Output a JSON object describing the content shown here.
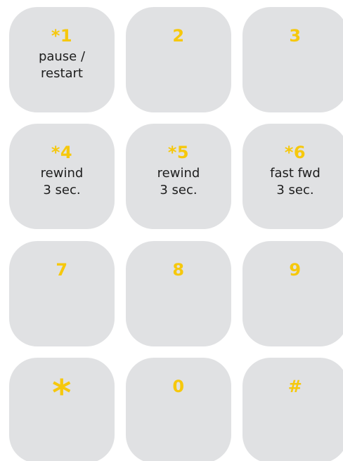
{
  "keypad": {
    "keys": [
      {
        "label": "*1",
        "desc": "pause /\nrestart"
      },
      {
        "label": "2",
        "desc": ""
      },
      {
        "label": "3",
        "desc": ""
      },
      {
        "label": "*4",
        "desc": "rewind\n3 sec."
      },
      {
        "label": "*5",
        "desc": "rewind\n3 sec."
      },
      {
        "label": "*6",
        "desc": "fast fwd\n3 sec."
      },
      {
        "label": "7",
        "desc": ""
      },
      {
        "label": "8",
        "desc": ""
      },
      {
        "label": "9",
        "desc": ""
      },
      {
        "label": "*",
        "desc": ""
      },
      {
        "label": "0",
        "desc": ""
      },
      {
        "label": "#",
        "desc": ""
      }
    ],
    "colors": {
      "key_background": "#e0e1e3",
      "label_accent": "#f6c80c",
      "desc_text": "#1d1d1d"
    }
  }
}
